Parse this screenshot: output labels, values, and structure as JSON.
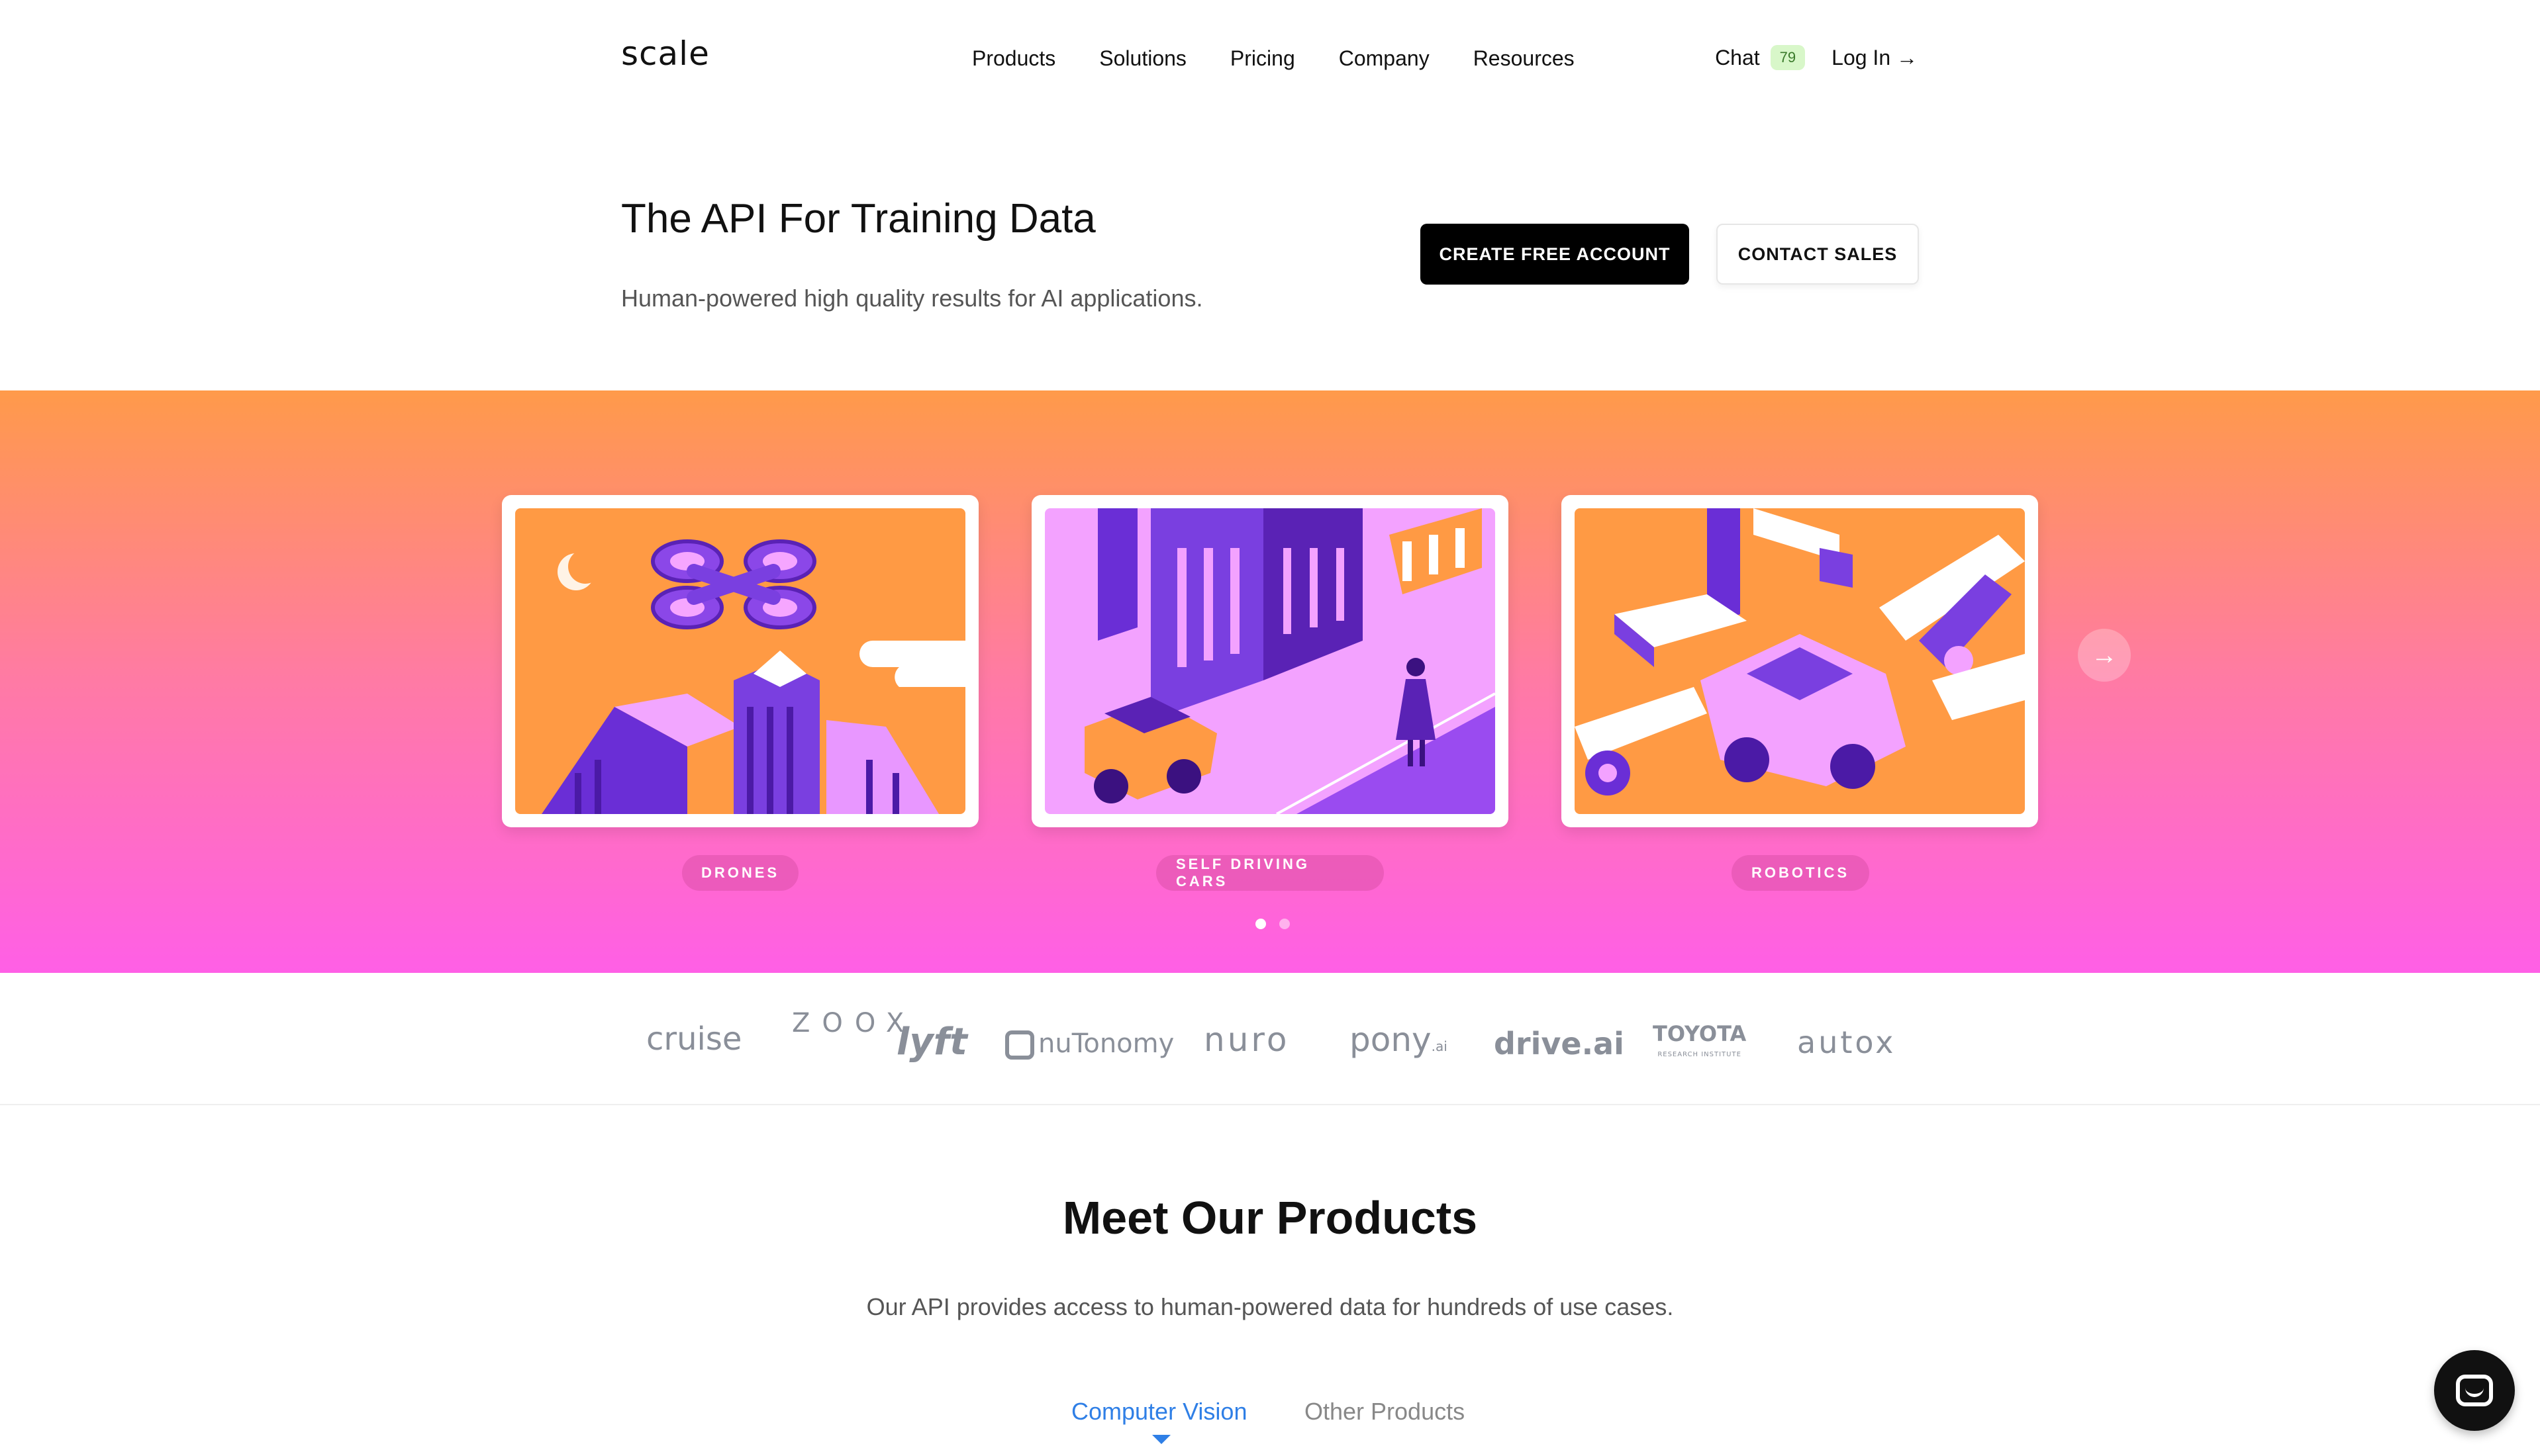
{
  "header": {
    "logo": "scale",
    "nav": [
      "Products",
      "Solutions",
      "Pricing",
      "Company",
      "Resources"
    ],
    "chat_label": "Chat",
    "chat_count": "79",
    "login_label": "Log In →"
  },
  "hero": {
    "title": "The API For Training Data",
    "subtitle": "Human-powered high quality results for AI applications.",
    "primary_button": "CREATE FREE ACCOUNT",
    "secondary_button": "CONTACT SALES"
  },
  "carousel": {
    "slides": [
      {
        "label": "DRONES",
        "illustration": "drone-city-illustration"
      },
      {
        "label": "SELF DRIVING CARS",
        "illustration": "city-street-taxi-illustration"
      },
      {
        "label": "ROBOTICS",
        "illustration": "robot-arms-car-factory-illustration"
      }
    ],
    "next_icon": "arrow-right-icon",
    "active_dot": 1,
    "dot_count": 2
  },
  "logos": {
    "cruise": "cruise",
    "zoox": "ZOOX",
    "lyft": "lyft",
    "nutonomy": "nuTonomy",
    "nuro": "nuro",
    "pony": "pony",
    "pony_suffix": ".ai",
    "drive": "drive.ai",
    "toyota": "TOYOTA",
    "toyota_sub": "RESEARCH INSTITUTE",
    "autox": "autox"
  },
  "products": {
    "title": "Meet Our Products",
    "subtitle": "Our API provides access to human-powered data for hundreds of use cases.",
    "tabs": [
      "Computer Vision",
      "Other Products"
    ],
    "active_tab": "Computer Vision"
  },
  "colors": {
    "accent_blue": "#2f7fe6",
    "gradient_top": "#ff9a4a",
    "gradient_bottom": "#ff5fe6",
    "purple": "#7a3fe0"
  }
}
